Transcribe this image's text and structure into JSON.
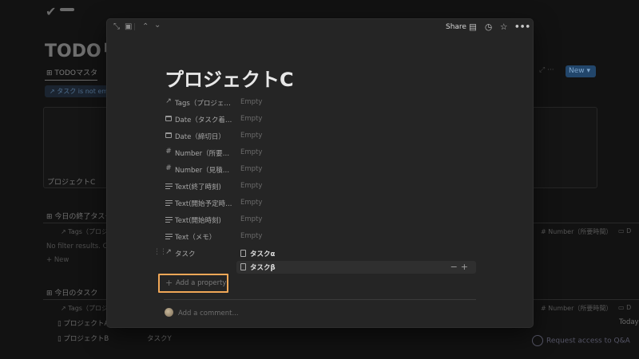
{
  "background": {
    "page_title": "TODOリ",
    "db_tab": "TODOマスタ",
    "filter_chip": "タスク is not emp",
    "card_title": "プロジェクトC",
    "new_button": "New",
    "section1_title": "今日の終了タスク",
    "section1_col_tags": "Tags（プロジ",
    "section1_no_results": "No filter results. Clic",
    "section1_new": "+ New",
    "section2_title": "今日のタスク",
    "section2_col_tags": "Tags（プロジ",
    "row1_name": "プロジェクトA",
    "row2_name": "プロジェクトB",
    "row2_task": "タスクY",
    "right_col_number1": "Number（所要時間）",
    "right_col_number2": "Number（所要時間）",
    "right_today": "Today",
    "access_label": "Request access to Q&A"
  },
  "modal": {
    "share_label": "Share",
    "title": "プロジェクトC",
    "properties": [
      {
        "icon": "arrow-up-right-icon",
        "label": "Tags（プロジェクト名）",
        "value": "Empty"
      },
      {
        "icon": "calendar-icon",
        "label": "Date（タスク着手日）",
        "value": "Empty"
      },
      {
        "icon": "calendar-icon",
        "label": "Date（締切日）",
        "value": "Empty"
      },
      {
        "icon": "hash-icon",
        "label": "Number（所要時間）",
        "value": "Empty"
      },
      {
        "icon": "hash-icon",
        "label": "Number（見積時間）",
        "value": "Empty"
      },
      {
        "icon": "text-icon",
        "label": "Text(終了時刻)",
        "value": "Empty"
      },
      {
        "icon": "text-icon",
        "label": "Text(開始予定時刻)",
        "value": "Empty"
      },
      {
        "icon": "text-icon",
        "label": "Text(開始時刻)",
        "value": "Empty"
      },
      {
        "icon": "text-icon",
        "label": "Text（メモ）",
        "value": "Empty"
      }
    ],
    "relation": {
      "label": "タスク",
      "items": [
        "タスクα",
        "タスクβ"
      ]
    },
    "add_property": "Add a property",
    "comment_placeholder": "Add a comment..."
  },
  "colors": {
    "highlight": "#f0a757",
    "modal_bg": "#252525",
    "accent_blue": "#22466b"
  }
}
